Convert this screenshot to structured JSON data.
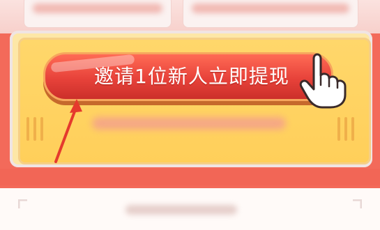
{
  "cta": {
    "label": "邀请1位新人立即提现"
  },
  "icons": {
    "pointer_hand": "pointer-hand-icon",
    "annotation_arrow": "red-arrow-annotation-icon"
  },
  "colors": {
    "page_background": "#f36a5a",
    "panel_fill": "#ffd76b",
    "button_fill": "#e7423a",
    "button_text": "#ffffff",
    "annotation_arrow": "#e53a2d"
  }
}
